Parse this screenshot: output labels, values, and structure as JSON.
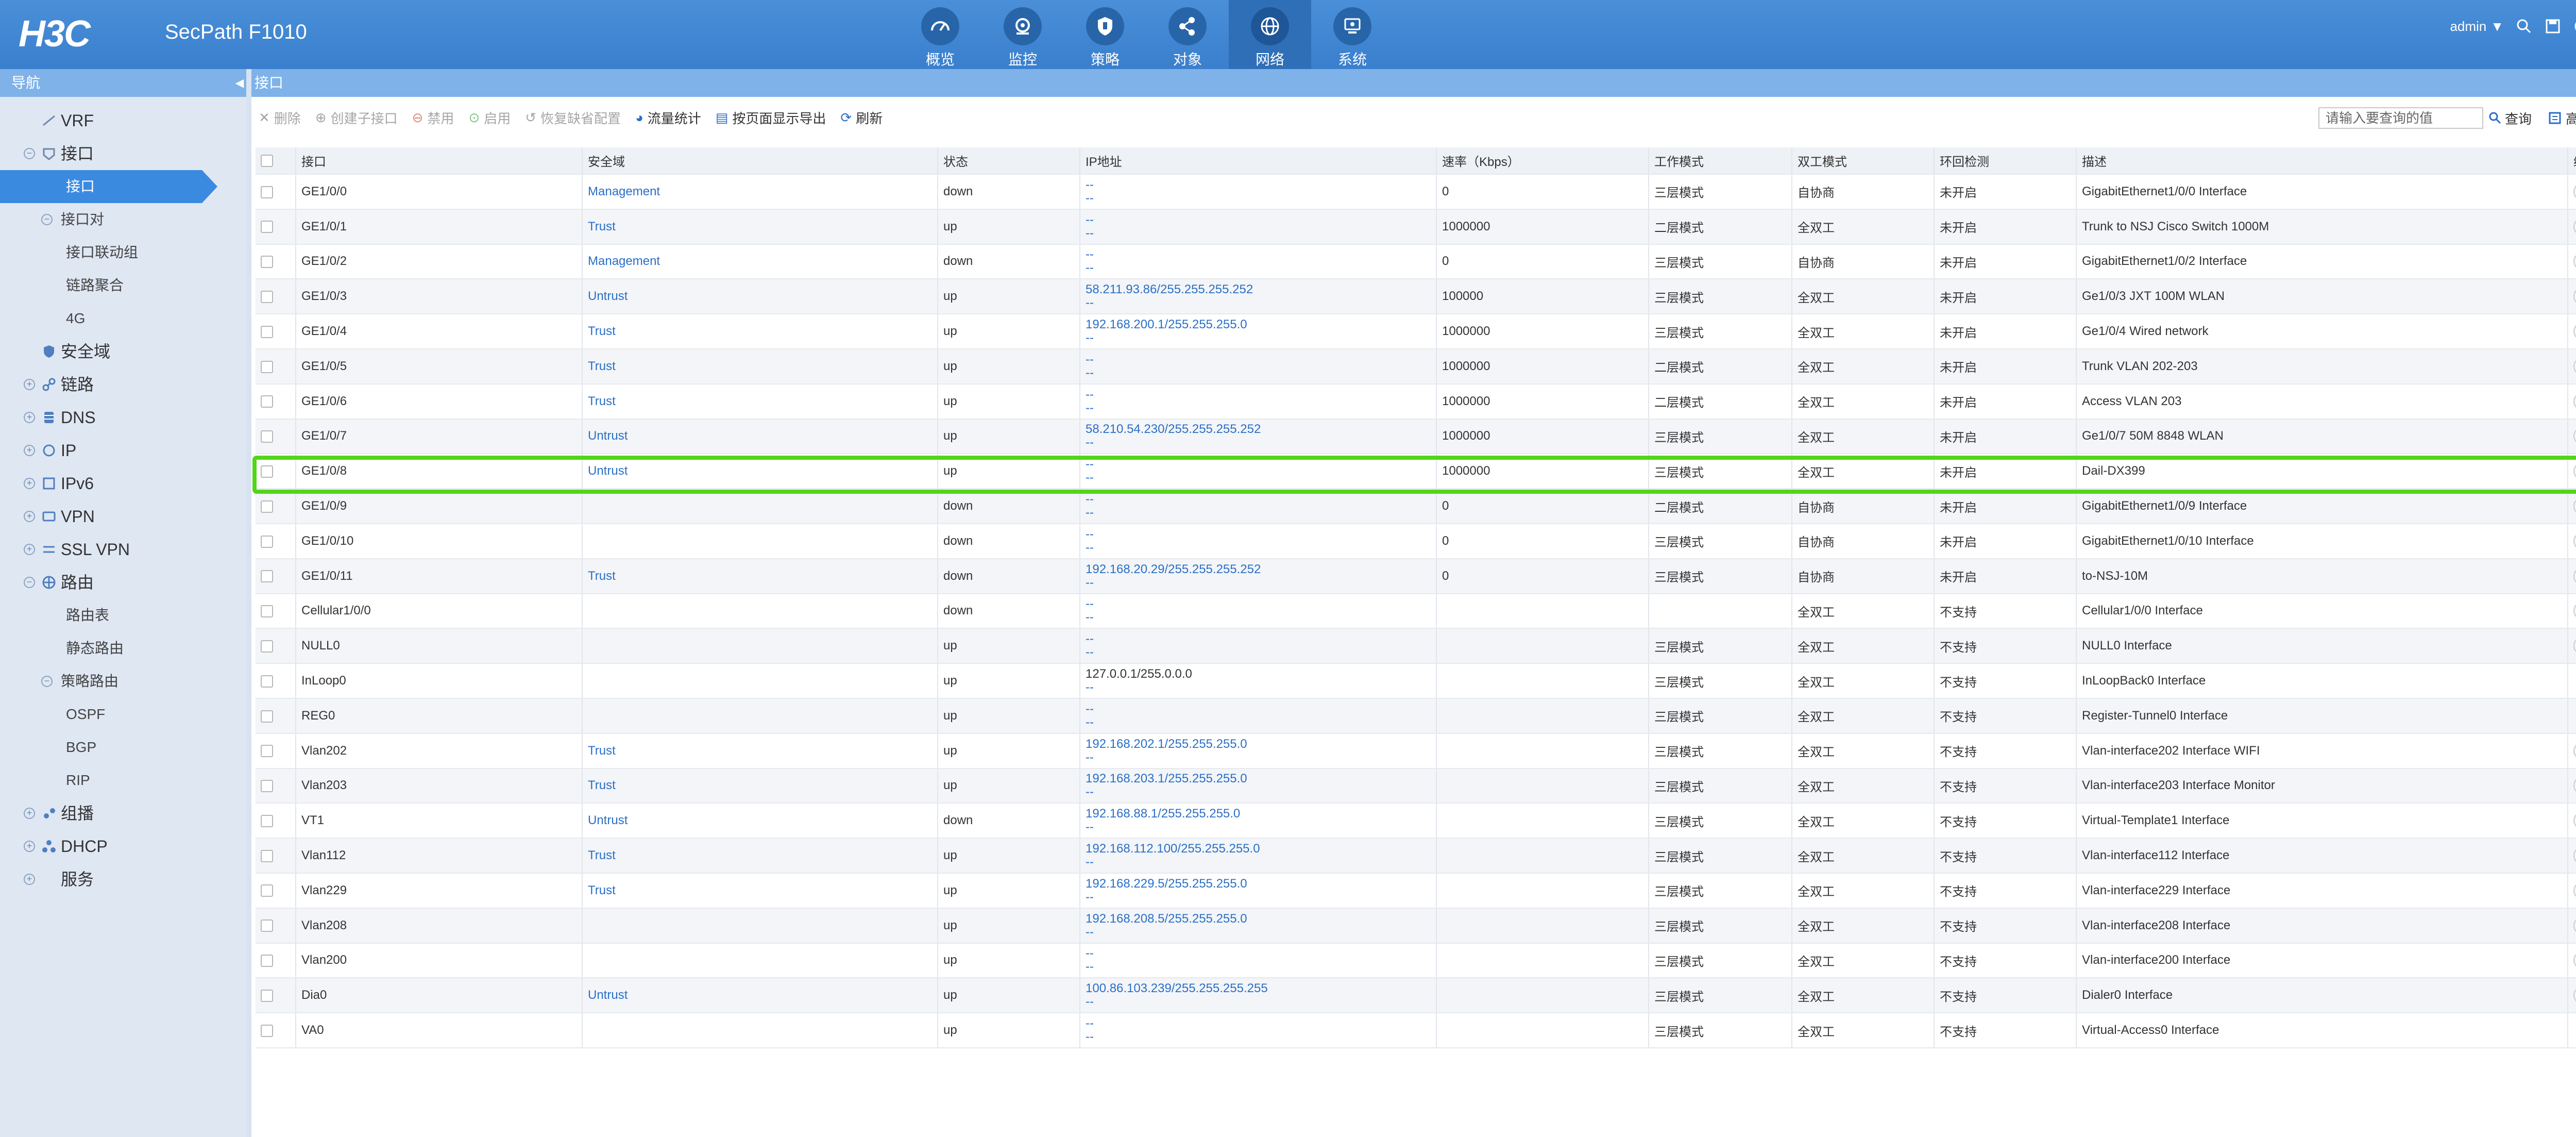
{
  "header": {
    "brand": "H3C",
    "product": "SecPath F1010",
    "user": "admin",
    "accent": "#4a8fd8",
    "nav": [
      {
        "label": "概览",
        "icon": "dashboard-icon"
      },
      {
        "label": "监控",
        "icon": "monitor-icon"
      },
      {
        "label": "策略",
        "icon": "shield-icon"
      },
      {
        "label": "对象",
        "icon": "share-icon"
      },
      {
        "label": "网络",
        "icon": "globe-icon",
        "active": true
      },
      {
        "label": "系统",
        "icon": "computer-icon"
      }
    ]
  },
  "sidebar": {
    "title": "导航",
    "items": [
      {
        "label": "VRF"
      },
      {
        "label": "接口"
      },
      {
        "label": "接口",
        "active": true
      },
      {
        "label": "接口对"
      },
      {
        "label": "接口联动组"
      },
      {
        "label": "链路聚合"
      },
      {
        "label": "4G"
      },
      {
        "label": "安全域"
      },
      {
        "label": "链路"
      },
      {
        "label": "DNS"
      },
      {
        "label": "IP"
      },
      {
        "label": "IPv6"
      },
      {
        "label": "VPN"
      },
      {
        "label": "SSL VPN"
      },
      {
        "label": "路由"
      },
      {
        "label": "路由表"
      },
      {
        "label": "静态路由"
      },
      {
        "label": "策略路由"
      },
      {
        "label": "OSPF"
      },
      {
        "label": "BGP"
      },
      {
        "label": "RIP"
      },
      {
        "label": "组播"
      },
      {
        "label": "DHCP"
      },
      {
        "label": "服务"
      }
    ]
  },
  "page": {
    "title": "接口"
  },
  "toolbar": {
    "delete": "删除",
    "create_sub": "创建子接口",
    "disable": "禁用",
    "enable": "启用",
    "restore": "恢复缺省配置",
    "traffic": "流量统计",
    "export": "按页面显示导出",
    "refresh": "刷新",
    "search_placeholder": "请输入要查询的值",
    "search": "查询",
    "advanced": "高级查询"
  },
  "table": {
    "columns": [
      "接口",
      "安全域",
      "状态",
      "IP地址",
      "速率（Kbps）",
      "工作模式",
      "双工模式",
      "环回检测",
      "描述",
      "编辑"
    ],
    "rows": [
      {
        "name": "GE1/0/0",
        "zone": "Management",
        "status": "down",
        "ip": "--",
        "ip2": "--",
        "rate": "0",
        "mode": "三层模式",
        "duplex": "自协商",
        "loop": "未开启",
        "desc": "GigabitEthernet1/0/0 Interface",
        "edit": true
      },
      {
        "name": "GE1/0/1",
        "zone": "Trust",
        "status": "up",
        "ip": "--",
        "ip2": "--",
        "rate": "1000000",
        "mode": "二层模式",
        "duplex": "全双工",
        "loop": "未开启",
        "desc": "Trunk to NSJ Cisco Switch 1000M",
        "edit": true
      },
      {
        "name": "GE1/0/2",
        "zone": "Management",
        "status": "down",
        "ip": "--",
        "ip2": "--",
        "rate": "0",
        "mode": "三层模式",
        "duplex": "自协商",
        "loop": "未开启",
        "desc": "GigabitEthernet1/0/2 Interface",
        "edit": true
      },
      {
        "name": "GE1/0/3",
        "zone": "Untrust",
        "status": "up",
        "ip": "58.211.93.86/255.255.255.252",
        "ip2": "--",
        "rate": "100000",
        "mode": "三层模式",
        "duplex": "全双工",
        "loop": "未开启",
        "desc": "Ge1/0/3 JXT 100M WLAN",
        "edit": true
      },
      {
        "name": "GE1/0/4",
        "zone": "Trust",
        "status": "up",
        "ip": "192.168.200.1/255.255.255.0",
        "ip2": "--",
        "rate": "1000000",
        "mode": "三层模式",
        "duplex": "全双工",
        "loop": "未开启",
        "desc": "Ge1/0/4 Wired network",
        "edit": true
      },
      {
        "name": "GE1/0/5",
        "zone": "Trust",
        "status": "up",
        "ip": "--",
        "ip2": "--",
        "rate": "1000000",
        "mode": "二层模式",
        "duplex": "全双工",
        "loop": "未开启",
        "desc": "Trunk VLAN 202-203",
        "edit": true
      },
      {
        "name": "GE1/0/6",
        "zone": "Trust",
        "status": "up",
        "ip": "--",
        "ip2": "--",
        "rate": "1000000",
        "mode": "二层模式",
        "duplex": "全双工",
        "loop": "未开启",
        "desc": "Access VLAN 203",
        "edit": true
      },
      {
        "name": "GE1/0/7",
        "zone": "Untrust",
        "status": "up",
        "ip": "58.210.54.230/255.255.255.252",
        "ip2": "--",
        "rate": "1000000",
        "mode": "三层模式",
        "duplex": "全双工",
        "loop": "未开启",
        "desc": "Ge1/0/7 50M 8848 WLAN",
        "edit": true
      },
      {
        "name": "GE1/0/8",
        "zone": "Untrust",
        "status": "up",
        "ip": "--",
        "ip2": "--",
        "rate": "1000000",
        "mode": "三层模式",
        "duplex": "全双工",
        "loop": "未开启",
        "desc": "Dail-DX399",
        "edit": true
      },
      {
        "name": "GE1/0/9",
        "zone": "",
        "status": "down",
        "ip": "--",
        "ip2": "--",
        "rate": "0",
        "mode": "二层模式",
        "duplex": "自协商",
        "loop": "未开启",
        "desc": "GigabitEthernet1/0/9 Interface",
        "edit": true
      },
      {
        "name": "GE1/0/10",
        "zone": "",
        "status": "down",
        "ip": "--",
        "ip2": "--",
        "rate": "0",
        "mode": "三层模式",
        "duplex": "自协商",
        "loop": "未开启",
        "desc": "GigabitEthernet1/0/10 Interface",
        "edit": true
      },
      {
        "name": "GE1/0/11",
        "zone": "Trust",
        "status": "down",
        "ip": "192.168.20.29/255.255.255.252",
        "ip2": "--",
        "rate": "0",
        "mode": "三层模式",
        "duplex": "自协商",
        "loop": "未开启",
        "desc": "to-NSJ-10M",
        "edit": true
      },
      {
        "name": "Cellular1/0/0",
        "zone": "",
        "status": "down",
        "ip": "--",
        "ip2": "--",
        "rate": "",
        "mode": "",
        "duplex": "全双工",
        "loop": "不支持",
        "desc": "Cellular1/0/0 Interface",
        "edit": true
      },
      {
        "name": "NULL0",
        "zone": "",
        "status": "up",
        "ip": "--",
        "ip2": "--",
        "rate": "",
        "mode": "三层模式",
        "duplex": "全双工",
        "loop": "不支持",
        "desc": "NULL0 Interface",
        "edit": true
      },
      {
        "name": "InLoop0",
        "zone": "",
        "status": "up",
        "ip": "127.0.0.1/255.0.0.0",
        "ip2": "--",
        "rate": "",
        "mode": "三层模式",
        "duplex": "全双工",
        "loop": "不支持",
        "desc": "InLoopBack0 Interface",
        "edit": false
      },
      {
        "name": "REG0",
        "zone": "",
        "status": "up",
        "ip": "--",
        "ip2": "--",
        "rate": "",
        "mode": "三层模式",
        "duplex": "全双工",
        "loop": "不支持",
        "desc": "Register-Tunnel0 Interface",
        "edit": false
      },
      {
        "name": "Vlan202",
        "zone": "Trust",
        "status": "up",
        "ip": "192.168.202.1/255.255.255.0",
        "ip2": "--",
        "rate": "",
        "mode": "三层模式",
        "duplex": "全双工",
        "loop": "不支持",
        "desc": "Vlan-interface202 Interface WIFI",
        "edit": true
      },
      {
        "name": "Vlan203",
        "zone": "Trust",
        "status": "up",
        "ip": "192.168.203.1/255.255.255.0",
        "ip2": "--",
        "rate": "",
        "mode": "三层模式",
        "duplex": "全双工",
        "loop": "不支持",
        "desc": "Vlan-interface203 Interface Monitor",
        "edit": true
      },
      {
        "name": "VT1",
        "zone": "Untrust",
        "status": "down",
        "ip": "192.168.88.1/255.255.255.0",
        "ip2": "--",
        "rate": "",
        "mode": "三层模式",
        "duplex": "全双工",
        "loop": "不支持",
        "desc": "Virtual-Template1 Interface",
        "edit": true
      },
      {
        "name": "Vlan112",
        "zone": "Trust",
        "status": "up",
        "ip": "192.168.112.100/255.255.255.0",
        "ip2": "--",
        "rate": "",
        "mode": "三层模式",
        "duplex": "全双工",
        "loop": "不支持",
        "desc": "Vlan-interface112 Interface",
        "edit": true
      },
      {
        "name": "Vlan229",
        "zone": "Trust",
        "status": "up",
        "ip": "192.168.229.5/255.255.255.0",
        "ip2": "--",
        "rate": "",
        "mode": "三层模式",
        "duplex": "全双工",
        "loop": "不支持",
        "desc": "Vlan-interface229 Interface",
        "edit": true
      },
      {
        "name": "Vlan208",
        "zone": "",
        "status": "up",
        "ip": "192.168.208.5/255.255.255.0",
        "ip2": "--",
        "rate": "",
        "mode": "三层模式",
        "duplex": "全双工",
        "loop": "不支持",
        "desc": "Vlan-interface208 Interface",
        "edit": true
      },
      {
        "name": "Vlan200",
        "zone": "",
        "status": "up",
        "ip": "--",
        "ip2": "--",
        "rate": "",
        "mode": "三层模式",
        "duplex": "全双工",
        "loop": "不支持",
        "desc": "Vlan-interface200 Interface",
        "edit": true
      },
      {
        "name": "Dia0",
        "zone": "Untrust",
        "status": "up",
        "ip": "100.86.103.239/255.255.255.255",
        "ip2": "--",
        "rate": "",
        "mode": "三层模式",
        "duplex": "全双工",
        "loop": "不支持",
        "desc": "Dialer0 Interface",
        "edit": true
      },
      {
        "name": "VA0",
        "zone": "",
        "status": "up",
        "ip": "--",
        "ip2": "--",
        "rate": "",
        "mode": "三层模式",
        "duplex": "全双工",
        "loop": "不支持",
        "desc": "Virtual-Access0 Interface",
        "edit": false
      }
    ]
  }
}
